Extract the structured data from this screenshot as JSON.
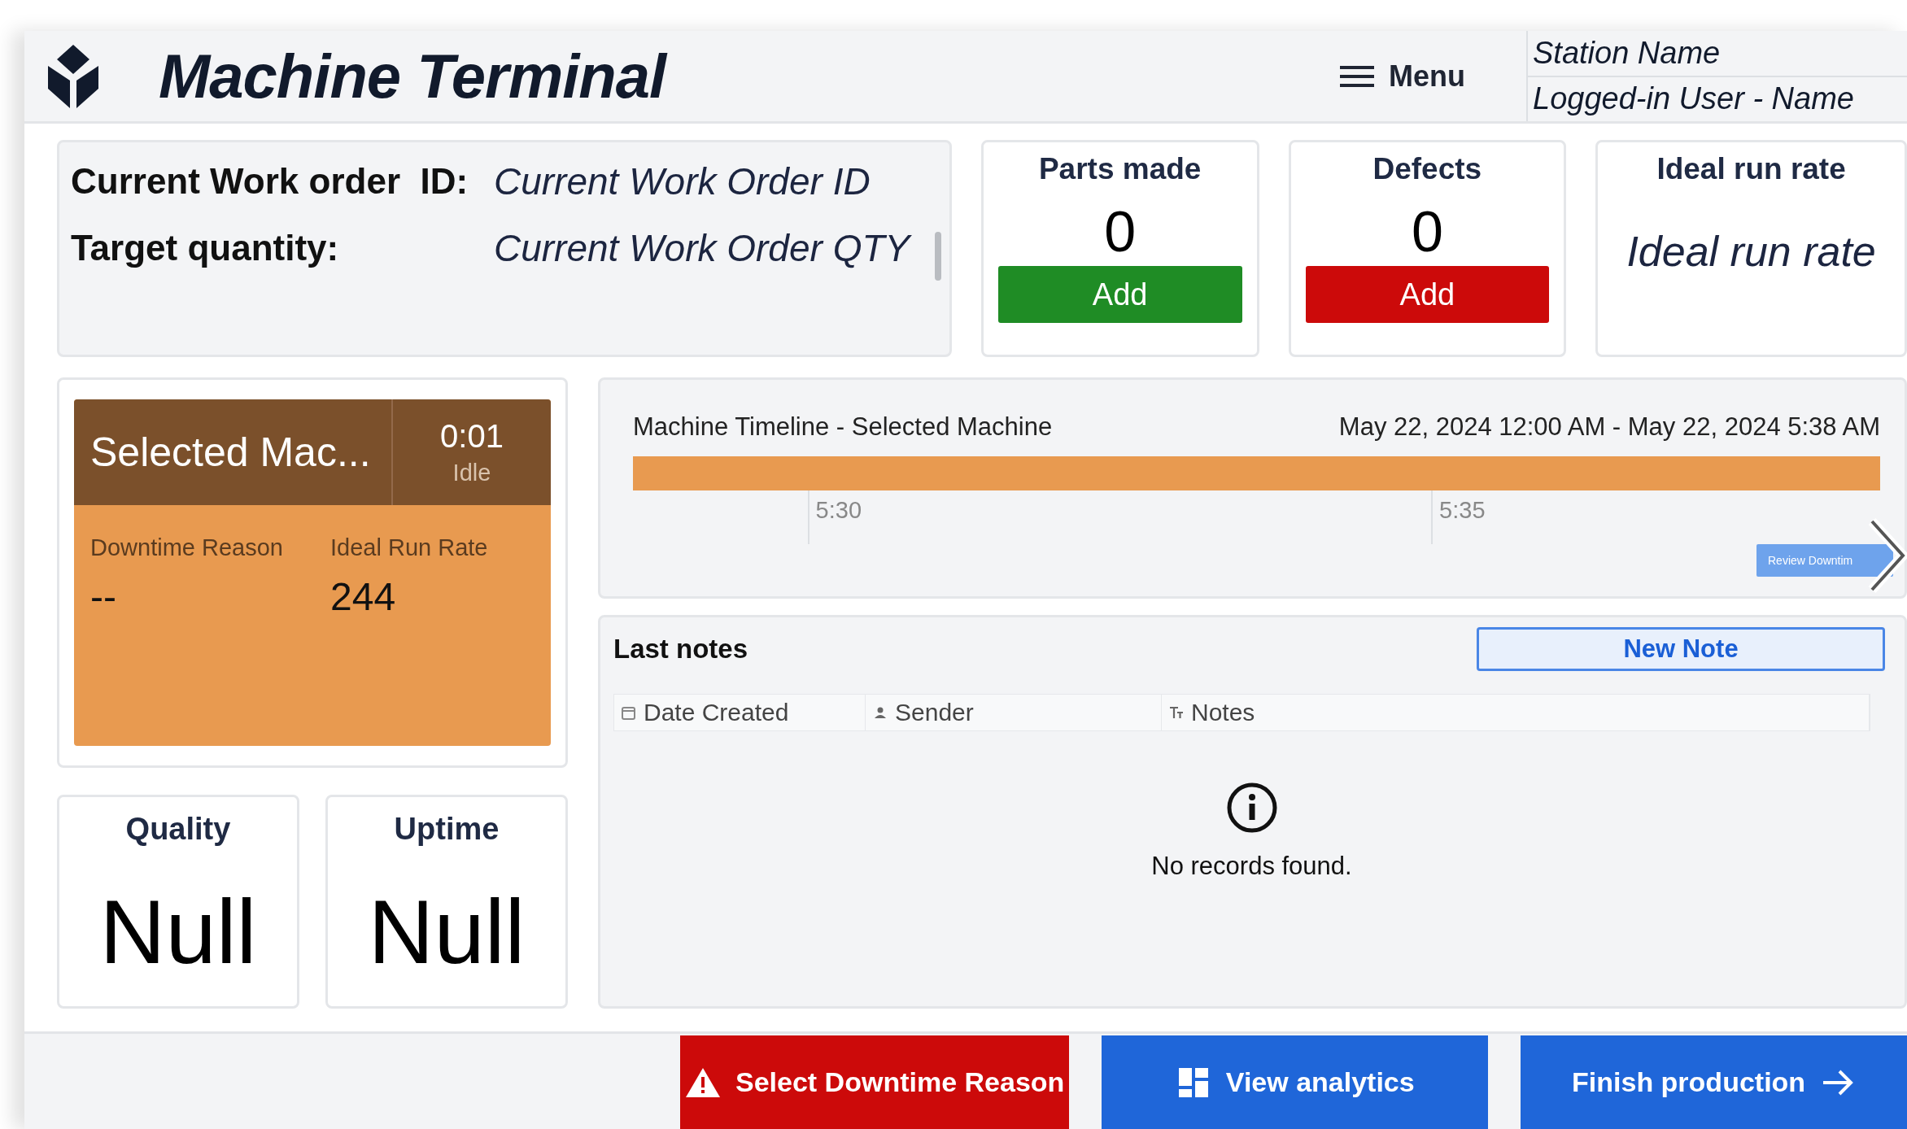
{
  "header": {
    "title": "Machine Terminal",
    "menu_label": "Menu",
    "station_name": "Station Name",
    "user_name": "Logged-in User - Name"
  },
  "work_order": {
    "fields": [
      {
        "label": "Current Work order  ID:",
        "value": "Current Work Order ID"
      },
      {
        "label": "Target quantity:",
        "value": "Current Work Order QTY"
      }
    ]
  },
  "stats": [
    {
      "kind": "counter",
      "title": "Parts made",
      "value": "0",
      "button": {
        "label": "Add",
        "color": "#1f8c25"
      }
    },
    {
      "kind": "counter",
      "title": "Defects",
      "value": "0",
      "button": {
        "label": "Add",
        "color": "#cc0a0a"
      }
    },
    {
      "kind": "text",
      "title": "Ideal run rate",
      "value": "Ideal run rate"
    }
  ],
  "machine": {
    "name": "Selected Mac...",
    "timer": "0:01",
    "status": "Idle",
    "fields": [
      {
        "label": "Downtime Reason",
        "value": "--"
      },
      {
        "label": "Ideal Run Rate",
        "value": "244"
      }
    ]
  },
  "kpis": [
    {
      "title": "Quality",
      "value": "Null"
    },
    {
      "title": "Uptime",
      "value": "Null"
    }
  ],
  "timeline": {
    "title": "Machine Timeline - Selected Machine",
    "range": "May 22, 2024 12:00 AM - May 22, 2024 5:38 AM",
    "ticks": [
      "5:30",
      "5:35"
    ],
    "review_button": "Review Downtim"
  },
  "notes": {
    "title": "Last notes",
    "new_button": "New Note",
    "columns": [
      {
        "label": "Date Created",
        "kind": "date"
      },
      {
        "label": "Sender",
        "kind": "person"
      },
      {
        "label": "Notes",
        "kind": "text"
      }
    ],
    "empty_message": "No records found."
  },
  "actions": [
    {
      "label": "Select Downtime Reason",
      "kind": "warning",
      "color": "#cc0a0a"
    },
    {
      "label": "View analytics",
      "kind": "analytics",
      "color": "#1f66d9"
    },
    {
      "label": "Finish production",
      "kind": "finish",
      "color": "#1f66d9"
    }
  ]
}
